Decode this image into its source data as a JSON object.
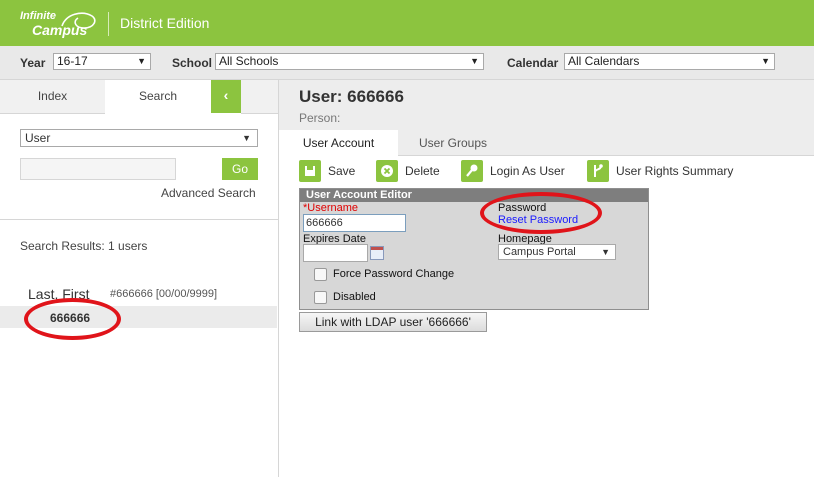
{
  "header": {
    "logo_line1": "Infinite",
    "logo_line2": "Campus",
    "edition": "District Edition"
  },
  "filters": {
    "year_label": "Year",
    "year_value": "16-17",
    "school_label": "School",
    "school_value": "All Schools",
    "calendar_label": "Calendar",
    "calendar_value": "All Calendars"
  },
  "left_panel": {
    "tabs": [
      "Index",
      "Search"
    ],
    "collapse_icon": "‹",
    "search_type": "User",
    "go_label": "Go",
    "advanced_search": "Advanced Search",
    "results_label": "Search Results: 1 users",
    "result": {
      "name": "Last, First",
      "meta": "#666666  [00/00/9999]",
      "username": "666666"
    }
  },
  "user": {
    "title": "User: 666666",
    "person_label": "Person:"
  },
  "tabs": [
    "User Account",
    "User Groups"
  ],
  "toolbar": {
    "save": "Save",
    "delete": "Delete",
    "login_as_user": "Login As User",
    "user_rights_summary": "User Rights Summary"
  },
  "editor": {
    "title": "User Account Editor",
    "username_required": "*",
    "username_label": "Username",
    "username_value": "666666",
    "expires_label": "Expires Date",
    "expires_value": "",
    "force_password_change": "Force Password Change",
    "disabled": "Disabled",
    "password_label": "Password",
    "reset_password": "Reset Password",
    "homepage_label": "Homepage",
    "homepage_value": "Campus Portal"
  },
  "ldap_button": "Link with LDAP user '666666'",
  "colors": {
    "brand_green": "#8cc43f",
    "annotation_red": "#e0141a",
    "link_blue": "#1a1aff"
  }
}
